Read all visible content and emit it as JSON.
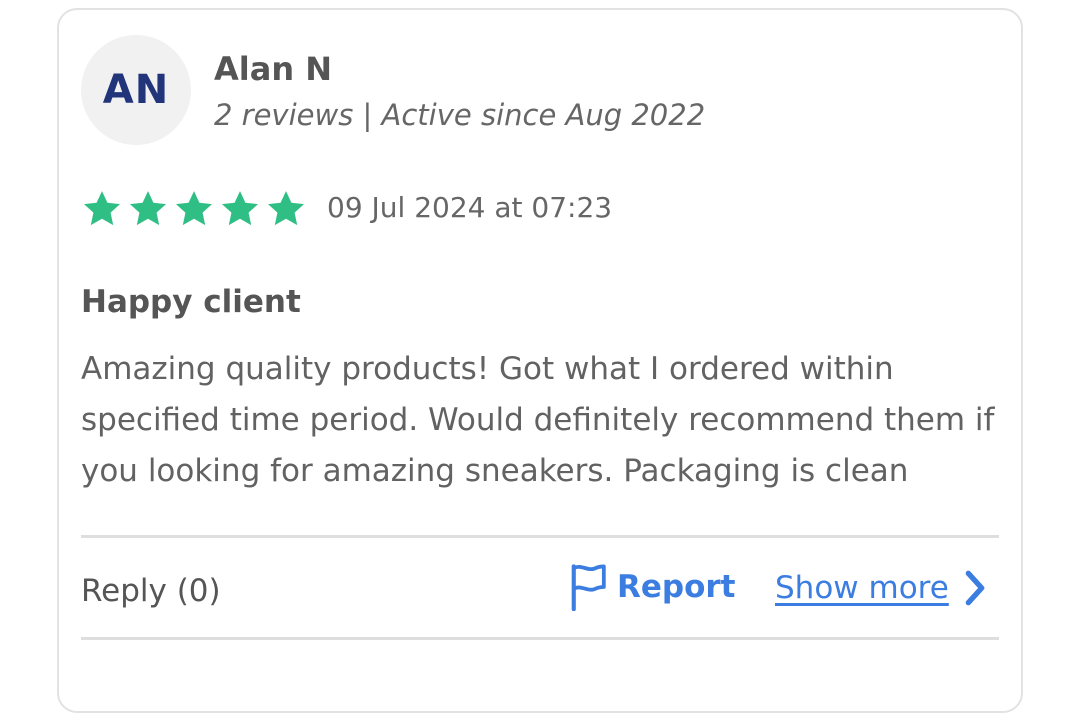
{
  "reviewer": {
    "initials": "AN",
    "name": "Alan N",
    "meta": "2 reviews | Active since Aug 2022"
  },
  "rating": {
    "stars": 5,
    "max": 5,
    "color": "#2fbf84"
  },
  "review": {
    "date": "09 Jul 2024 at 07:23",
    "title": "Happy client",
    "body": "Amazing quality products! Got what I ordered within specified time period. Would definitely recommend them if you looking for amazing sneakers. Packaging is clean"
  },
  "actions": {
    "reply_label": "Reply (0)",
    "report_label": "Report",
    "show_more_label": "Show more",
    "link_color": "#3b7de0"
  },
  "icons": {
    "star": "star-icon",
    "report": "flag-icon",
    "show_more": "chevron-right-icon"
  }
}
